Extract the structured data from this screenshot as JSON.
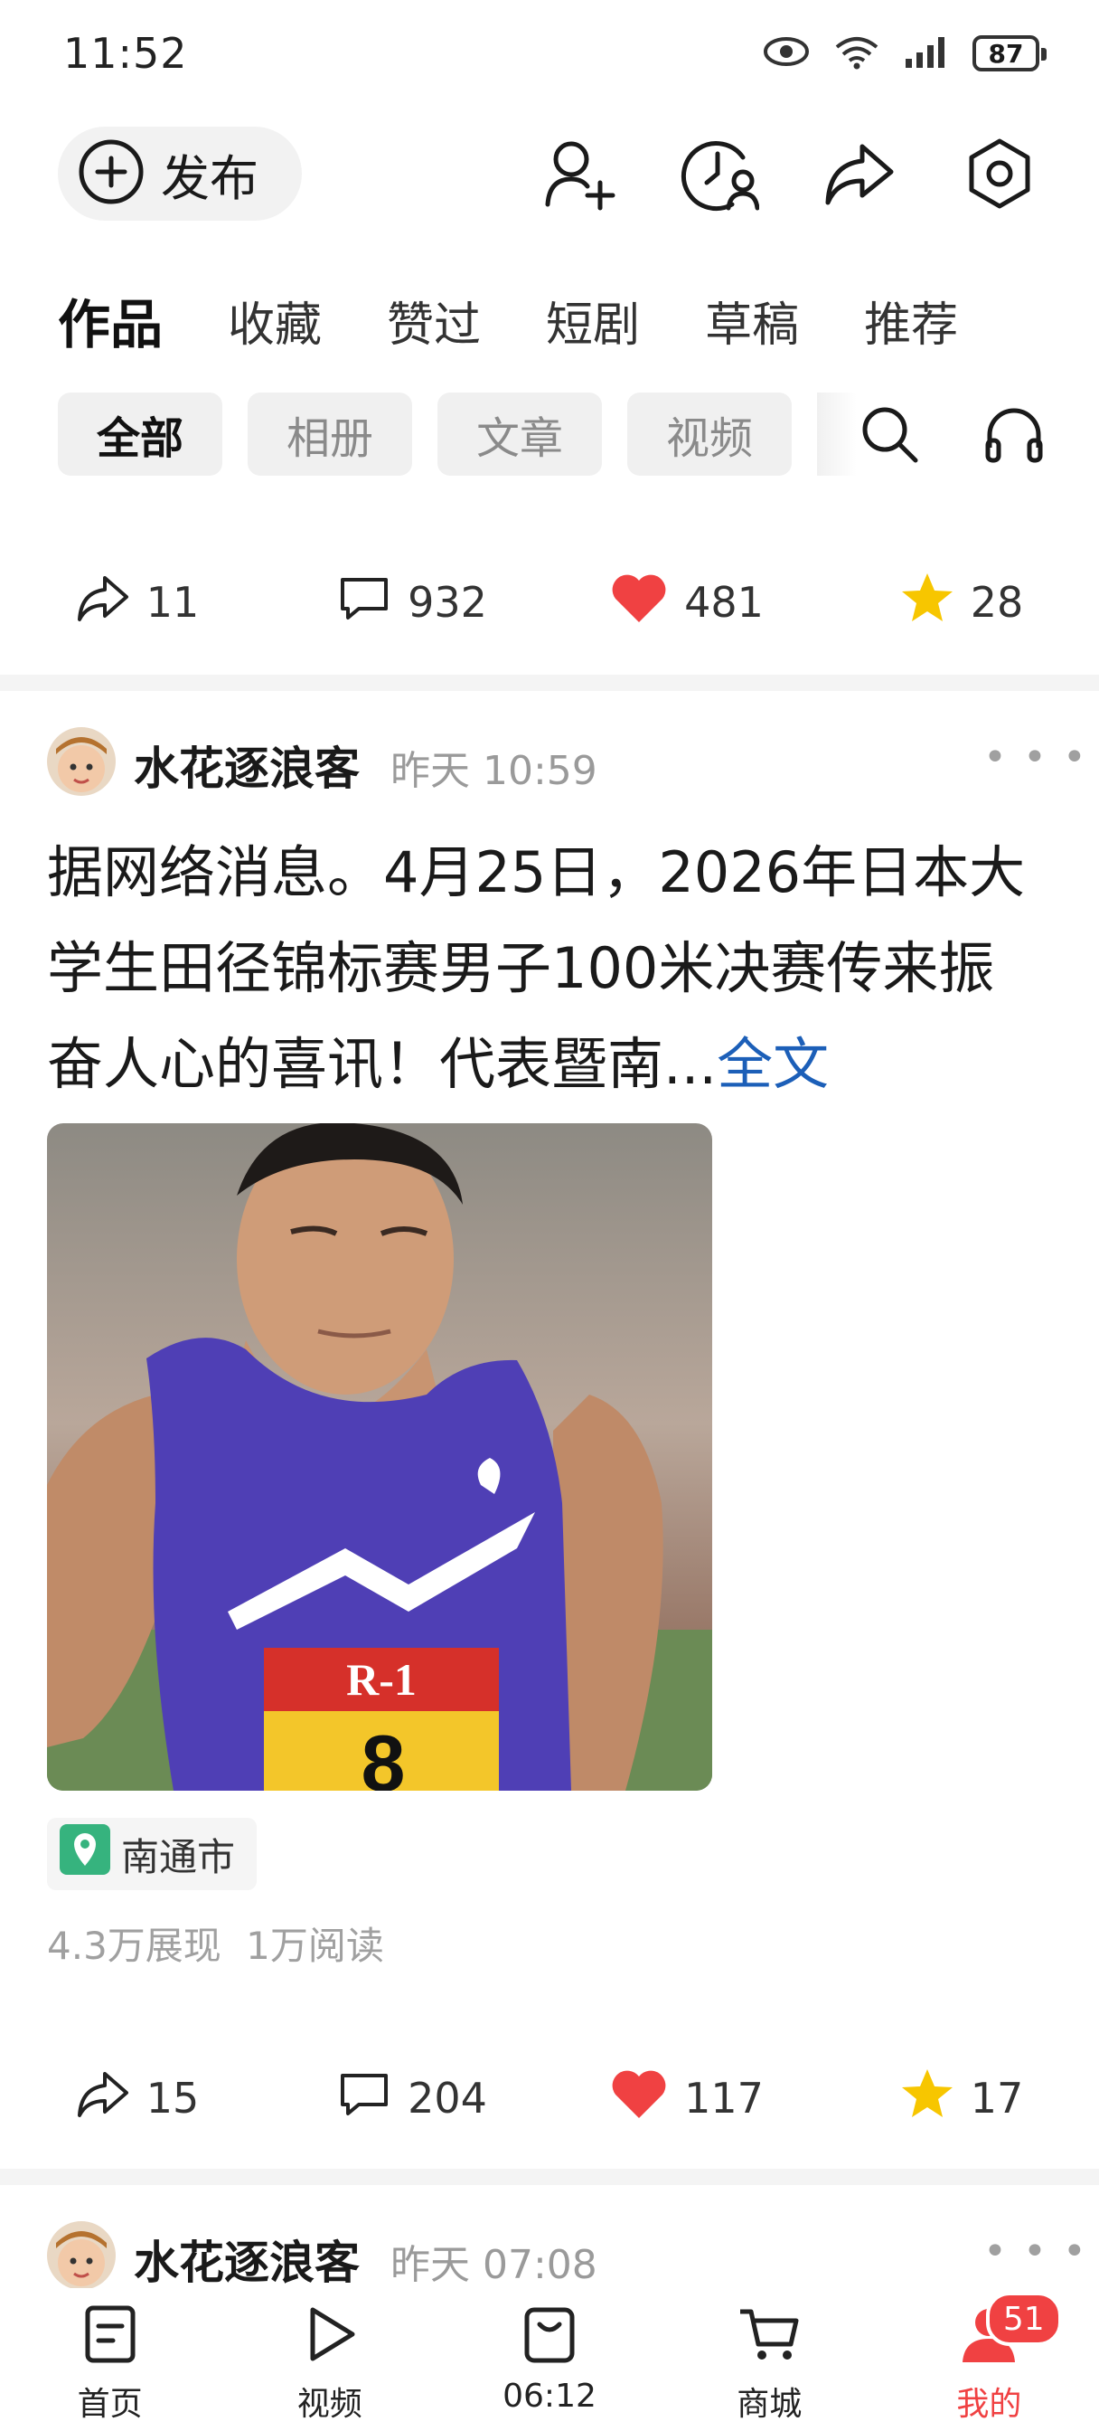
{
  "status_bar": {
    "time": "11:52",
    "battery": "87"
  },
  "actions": {
    "publish_label": "发布"
  },
  "tabs": [
    {
      "label": "作品",
      "active": true
    },
    {
      "label": "收藏",
      "active": false
    },
    {
      "label": "赞过",
      "active": false
    },
    {
      "label": "短剧",
      "active": false
    },
    {
      "label": "草稿",
      "active": false
    },
    {
      "label": "推荐",
      "active": false
    }
  ],
  "chips": [
    {
      "label": "全部",
      "active": true
    },
    {
      "label": "相册",
      "active": false
    },
    {
      "label": "文章",
      "active": false
    },
    {
      "label": "视频",
      "active": false
    }
  ],
  "prev_post_stats": {
    "share": "11",
    "comment": "932",
    "like": "481",
    "favorite": "28"
  },
  "post1": {
    "author": "水花逐浪客",
    "time": "昨天  10:59",
    "text": "据网络消息。4月25日，2026年日本大学生田径锦标赛男子100米决赛传来振奋人心的喜讯！代表暨南...",
    "more_link": "全文",
    "bib_text": "8",
    "location": "南通市",
    "views": "4.3万展现  1万阅读",
    "stats": {
      "share": "15",
      "comment": "204",
      "like": "117",
      "favorite": "17"
    }
  },
  "post2": {
    "author": "水花逐浪客",
    "time": "昨天  07:08"
  },
  "bottom_nav": {
    "items": [
      {
        "label": "首页"
      },
      {
        "label": "视频"
      },
      {
        "label": "06:12"
      },
      {
        "label": "商城"
      },
      {
        "label": "我的"
      }
    ],
    "badge": "51"
  },
  "colors": {
    "accent_red": "#f04142",
    "link_blue": "#1c5fb8",
    "star_yellow": "#f7c600"
  }
}
